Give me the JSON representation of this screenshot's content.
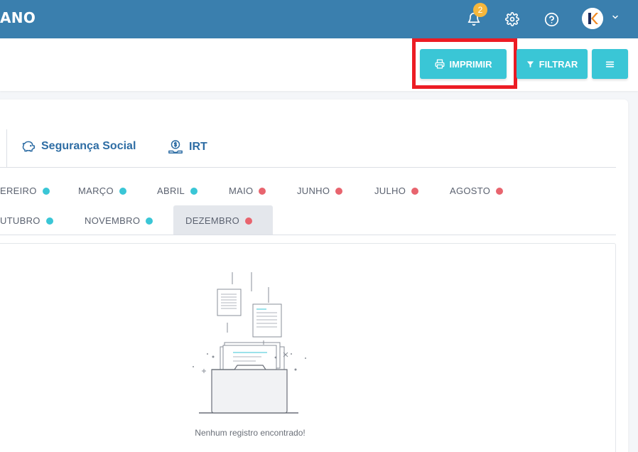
{
  "header": {
    "brand": "ANO",
    "notifications_count": "2",
    "icons": [
      "bell-icon",
      "gear-icon",
      "help-icon",
      "avatar",
      "chevron-down-icon"
    ]
  },
  "actions": {
    "print_label": "IMPRIMIR",
    "filter_label": "FILTRAR"
  },
  "tabs": [
    {
      "label": "Segurança Social",
      "icon": "piggy-bank-icon"
    },
    {
      "label": "IRT",
      "icon": "money-hand-icon"
    }
  ],
  "months": [
    {
      "label": "EREIRO",
      "status": "cyan"
    },
    {
      "label": "MARÇO",
      "status": "cyan"
    },
    {
      "label": "ABRIL",
      "status": "cyan"
    },
    {
      "label": "MAIO",
      "status": "red"
    },
    {
      "label": "JUNHO",
      "status": "red"
    },
    {
      "label": "JULHO",
      "status": "red"
    },
    {
      "label": "AGOSTO",
      "status": "red"
    },
    {
      "label": "UTUBRO",
      "status": "cyan"
    },
    {
      "label": "NOVEMBRO",
      "status": "cyan"
    },
    {
      "label": "DEZEMBRO",
      "status": "red",
      "active": true
    }
  ],
  "empty": {
    "message": "Nenhum registro encontrado!"
  },
  "colors": {
    "header": "#3a7fae",
    "accent": "#3ac6d6",
    "tab_text": "#2e6da4",
    "status_cyan": "#3ac6d6",
    "status_red": "#e8646e",
    "badge": "#f6b73c",
    "highlight": "#ec1c24"
  }
}
